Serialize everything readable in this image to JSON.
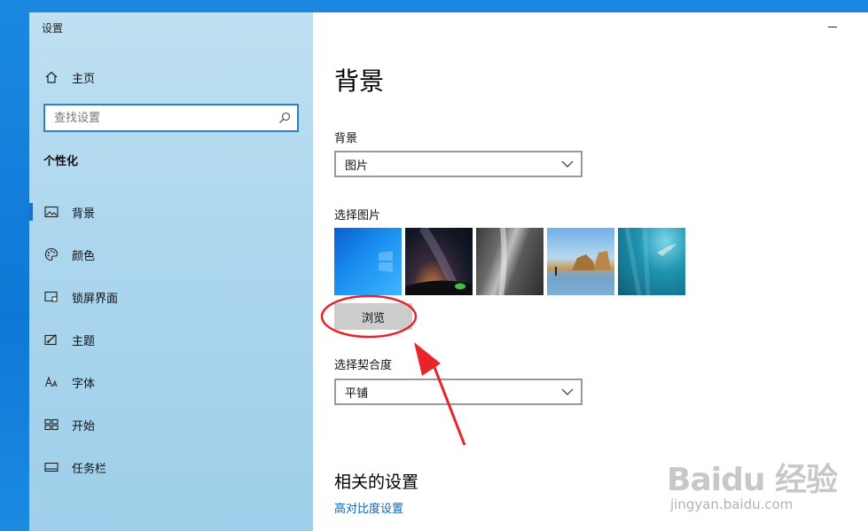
{
  "window": {
    "title": "设置"
  },
  "sidebar": {
    "home_label": "主页",
    "search_placeholder": "查找设置",
    "section_title": "个性化",
    "items": [
      {
        "label": "背景",
        "icon": "picture-icon",
        "active": true
      },
      {
        "label": "颜色",
        "icon": "palette-icon",
        "active": false
      },
      {
        "label": "锁屏界面",
        "icon": "lock-screen-icon",
        "active": false
      },
      {
        "label": "主题",
        "icon": "theme-icon",
        "active": false
      },
      {
        "label": "字体",
        "icon": "font-icon",
        "active": false
      },
      {
        "label": "开始",
        "icon": "start-icon",
        "active": false
      },
      {
        "label": "任务栏",
        "icon": "taskbar-icon",
        "active": false
      }
    ]
  },
  "main": {
    "page_title": "背景",
    "background_label": "背景",
    "background_value": "图片",
    "choose_picture_label": "选择图片",
    "browse_label": "浏览",
    "fit_label": "选择契合度",
    "fit_value": "平铺",
    "related_title": "相关的设置",
    "related_link": "高对比度设置"
  },
  "watermark": {
    "logo": "Baidu 经验",
    "url": "jingyan.baidu.com"
  },
  "colors": {
    "accent": "#1a6fc9",
    "link": "#0a64c8",
    "annotation": "#e8232a"
  }
}
